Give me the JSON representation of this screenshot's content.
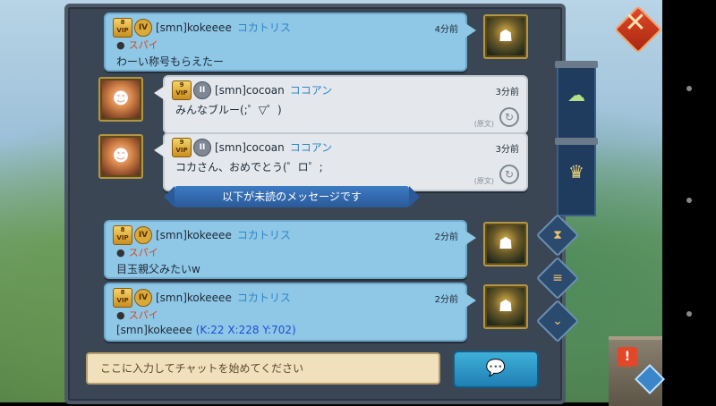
{
  "messages": [
    {
      "side": "right",
      "vip_level": "8",
      "vip_label": "VIP",
      "rank": "IV",
      "username": "[smn]kokeeee",
      "nickname": "コカトリス",
      "time": "4分前",
      "role": "スパイ",
      "text": "わーい称号もらえたー",
      "avatar": "knight-avatar"
    },
    {
      "side": "left",
      "vip_level": "9",
      "vip_label": "VIP",
      "rank": "II",
      "username": "[smn]cocoan",
      "nickname": "ココアン",
      "time": "3分前",
      "text": "みんなブルー(;゜▽゜)",
      "orig_label": "(原文)",
      "avatar": "mouse-avatar"
    },
    {
      "side": "left",
      "vip_level": "9",
      "vip_label": "VIP",
      "rank": "II",
      "username": "[smn]cocoan",
      "nickname": "ココアン",
      "time": "3分前",
      "text": "コカさん、おめでとう(゜ロ゜;",
      "orig_label": "(原文)",
      "avatar": "mouse-avatar"
    },
    {
      "side": "right",
      "vip_level": "8",
      "vip_label": "VIP",
      "rank": "IV",
      "username": "[smn]kokeeee",
      "nickname": "コカトリス",
      "time": "2分前",
      "role": "スパイ",
      "text": "目玉親父みたいw",
      "avatar": "knight-avatar"
    },
    {
      "side": "right",
      "vip_level": "8",
      "vip_label": "VIP",
      "rank": "IV",
      "username": "[smn]kokeeee",
      "nickname": "コカトリス",
      "time": "2分前",
      "role": "スパイ",
      "text": "[smn]kokeeee",
      "coord": "(K:22 X:228 Y:702)",
      "avatar": "knight-avatar"
    }
  ],
  "unread_banner": "以下が未読のメッセージです",
  "input": {
    "placeholder": "ここに入力してチャットを始めてください"
  },
  "icons": {
    "close": "close-icon",
    "send": "chat-bubble-icon",
    "map_tab": "map-icon",
    "guild_tab": "guild-wings-icon",
    "hourglass": "hourglass-icon",
    "list": "list-icon",
    "scroll_down": "chevron-down-icon",
    "translate": "translate-icon",
    "bomb": "bomb-icon",
    "alert": "alert-icon"
  },
  "colors": {
    "panel": "#3a4654",
    "own_message": "#8fc7e6",
    "other_message": "#e4e8ec",
    "nickname": "#2f86c6",
    "spy": "#d84a1c",
    "coordinate_link": "#1a4fd6",
    "banner": "#2a5a98"
  }
}
